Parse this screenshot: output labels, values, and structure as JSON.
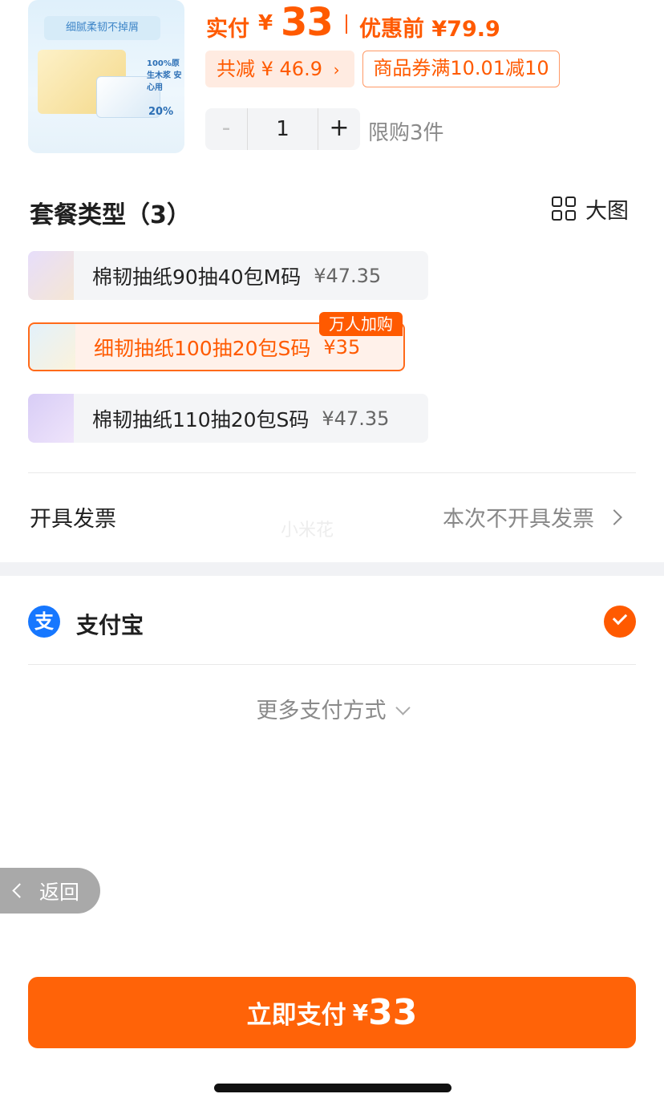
{
  "product": {
    "thumb_caption": "细腻柔韧不掉屑",
    "thumb_tag_1": "100%原生木浆 安心用",
    "thumb_tag_2": "20%",
    "pay_label": "实付",
    "currency": "¥",
    "pay_amount": "33",
    "original_price": "优惠前 ¥79.9",
    "discount": "共减 ¥ 46.9",
    "coupon": "商品券满10.01减10",
    "quantity": "1",
    "minus": "-",
    "plus": "+",
    "limit": "限购3件"
  },
  "packages": {
    "title": "套餐类型（3）",
    "view_label": "大图",
    "items": [
      {
        "name": "棉韧抽纸90抽40包M码",
        "price": "¥47.35",
        "selected": false
      },
      {
        "name": "细韧抽纸100抽20包S码",
        "price": "¥35",
        "selected": true,
        "badge": "万人加购"
      },
      {
        "name": "棉韧抽纸110抽20包S码",
        "price": "¥47.35",
        "selected": false
      }
    ]
  },
  "invoice": {
    "label": "开具发票",
    "value": "本次不开具发票"
  },
  "watermark": "小米花",
  "payment": {
    "method_icon": "支",
    "method": "支付宝",
    "more": "更多支付方式"
  },
  "back": {
    "label": "返回"
  },
  "submit": {
    "label": "立即支付",
    "currency": "¥",
    "amount": "33"
  },
  "colors": {
    "accent": "#ff5a00",
    "alipay": "#1677ff"
  }
}
